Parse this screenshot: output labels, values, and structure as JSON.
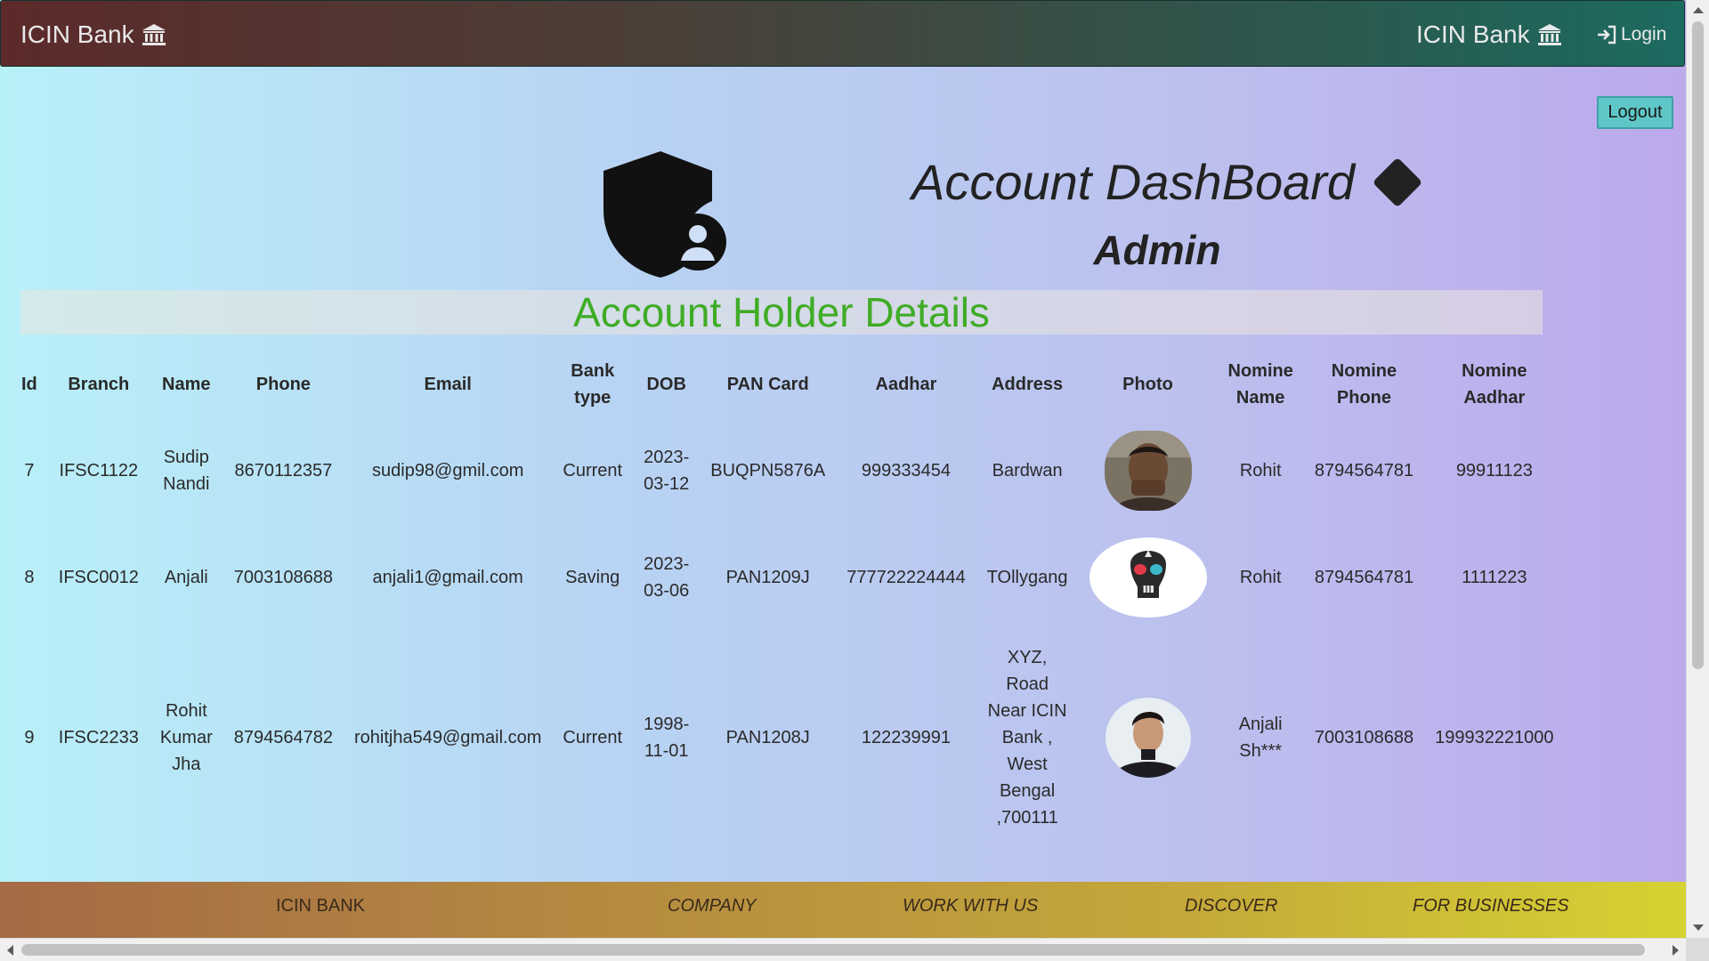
{
  "navbar": {
    "brand_left": "ICIN Bank",
    "brand_right": "ICIN Bank",
    "brand_icon": "bank-icon",
    "login_label": "Login",
    "login_icon": "login-arrow-icon"
  },
  "logout_label": "Logout",
  "dashboard": {
    "title": "Account DashBoard",
    "role": "Admin",
    "shield_icon": "shield-user-icon"
  },
  "section_title": "Account Holder Details",
  "table": {
    "headers": [
      "Id",
      "Branch",
      "Name",
      "Phone",
      "Email",
      "Bank type",
      "DOB",
      "PAN Card",
      "Aadhar",
      "Address",
      "Photo",
      "Nomine Name",
      "Nomine Phone",
      "Nomine Aadhar"
    ],
    "rows": [
      {
        "id": "7",
        "branch": "IFSC1122",
        "name": "Sudip Nandi",
        "phone": "8670112357",
        "email": "sudip98@gmil.com",
        "bank_type": "Current",
        "dob": "2023-03-12",
        "pan": "BUQPN5876A",
        "aadhar": "999333454",
        "address": "Bardwan",
        "nominee_name": "Rohit",
        "nominee_phone": "8794564781",
        "nominee_aadhar": "99911123"
      },
      {
        "id": "8",
        "branch": "IFSC0012",
        "name": "Anjali",
        "phone": "7003108688",
        "email": "anjali1@gmail.com",
        "bank_type": "Saving",
        "dob": "2023-03-06",
        "pan": "PAN1209J",
        "aadhar": "777722224444",
        "address": "TOllygang",
        "nominee_name": "Rohit",
        "nominee_phone": "8794564781",
        "nominee_aadhar": "1111223"
      },
      {
        "id": "9",
        "branch": "IFSC2233",
        "name": "Rohit Kumar Jha",
        "phone": "8794564782",
        "email": "rohitjha549@gmail.com",
        "bank_type": "Current",
        "dob": "1998-11-01",
        "pan": "PAN1208J",
        "aadhar": "122239991",
        "address": "XYZ, Road Near ICIN Bank , West Bengal ,700111",
        "nominee_name": "Anjali Sh***",
        "nominee_phone": "7003108688",
        "nominee_aadhar": "199932221000"
      }
    ]
  },
  "footer": {
    "col1": "ICIN BANK",
    "col2": "COMPANY",
    "col3": "WORK WITH US",
    "col4": "DISCOVER",
    "col5": "FOR BUSINESSES"
  },
  "colors": {
    "section_title": "#3fac26",
    "logout_bg": "#5fc7c7"
  }
}
